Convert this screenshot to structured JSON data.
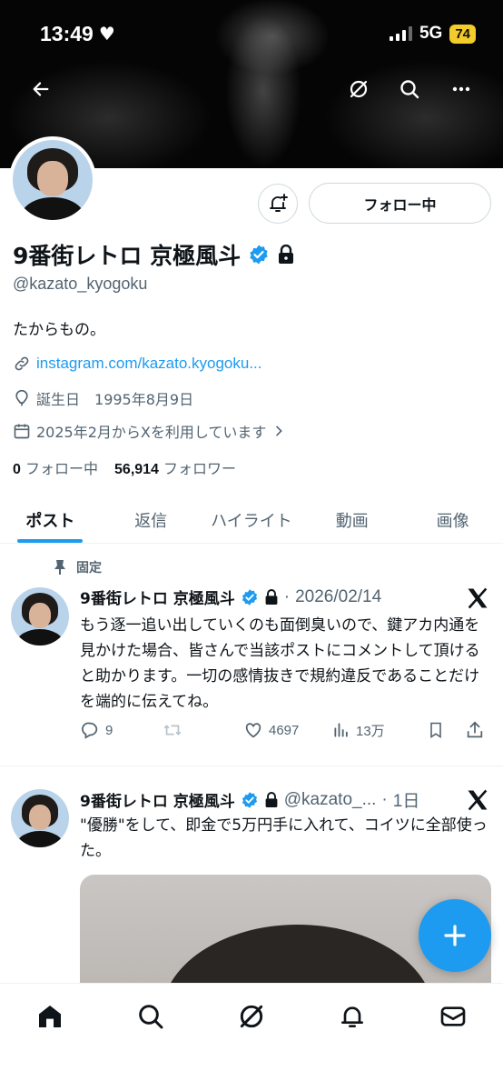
{
  "status_bar": {
    "time": "13:49",
    "network": "5G",
    "battery": "74"
  },
  "profile": {
    "name": "9番街レトロ 京極風斗",
    "handle": "@kazato_kyogoku",
    "bio": "たからもの。",
    "link": "instagram.com/kazato.kyogoku...",
    "birthday_label": "誕生日",
    "birthday": "1995年8月9日",
    "joined": "2025年2月からXを利用しています",
    "following_count": "0",
    "following_label": "フォロー中",
    "followers_count": "56,914",
    "followers_label": "フォロワー",
    "follow_button": "フォロー中",
    "verified_color": "#1d9bf0"
  },
  "tabs": [
    {
      "label": "ポスト",
      "active": true
    },
    {
      "label": "返信"
    },
    {
      "label": "ハイライト"
    },
    {
      "label": "動画"
    },
    {
      "label": "画像"
    }
  ],
  "posts": [
    {
      "pinned_label": "固定",
      "author": "9番街レトロ 京極風斗",
      "date": "2026/02/14",
      "text": "もう逐一追い出していくのも面倒臭いので、鍵アカ内通を見かけた場合、皆さんで当該ポストにコメントして頂けると助かります。一切の感情抜きで規約違反であることだけを端的に伝えてね。",
      "replies": "9",
      "likes": "4697",
      "views": "13万"
    },
    {
      "author": "9番街レトロ 京極風斗",
      "handle": "@kazato_...",
      "time": "1日",
      "text": "\"優勝\"をして、即金で5万円手に入れて、コイツに全部使った。"
    }
  ],
  "icons": [
    "back-arrow-icon",
    "grok-icon",
    "search-icon",
    "more-icon",
    "bell-plus-icon",
    "verified-icon",
    "lock-icon",
    "link-icon",
    "location-icon",
    "calendar-icon",
    "pin-icon",
    "x-logo-icon",
    "reply-icon",
    "repost-icon",
    "like-icon",
    "views-icon",
    "bookmark-icon",
    "share-icon",
    "compose-plus-icon",
    "home-icon",
    "notifications-icon",
    "messages-icon"
  ]
}
